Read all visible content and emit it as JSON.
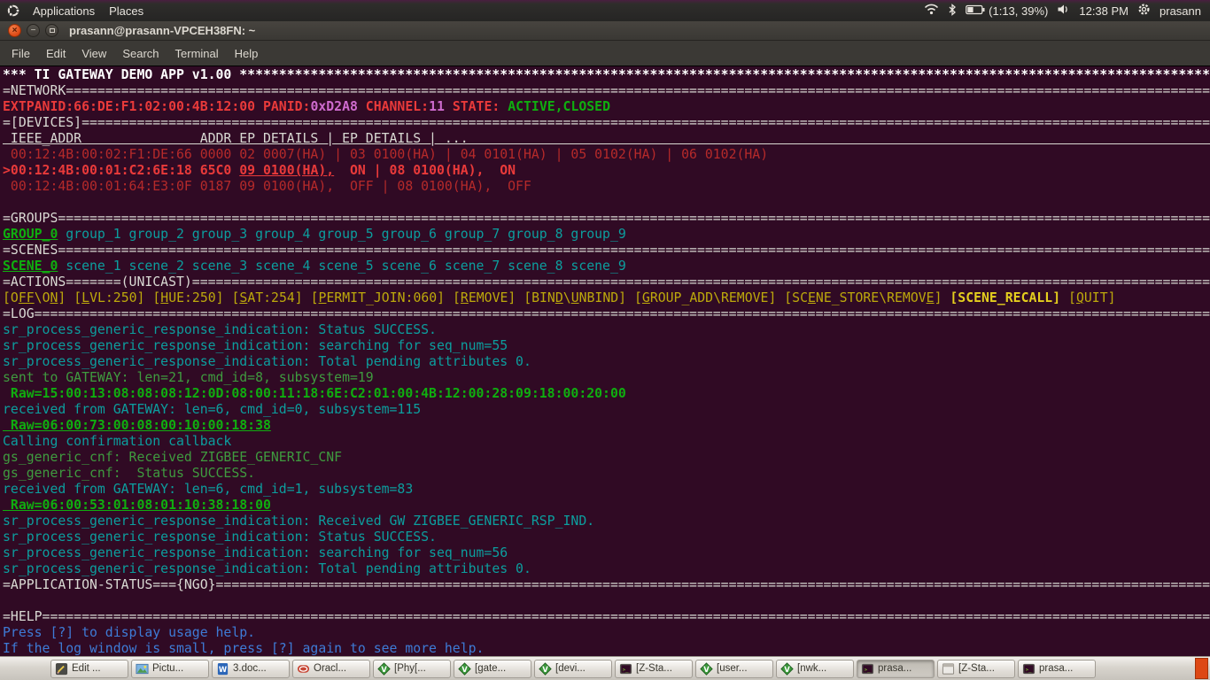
{
  "colors": {
    "white": "#D9D9D3",
    "red": "#B52A2A",
    "brightred": "#E93A3A",
    "magenta": "#CE6BCE",
    "green": "#3F9B3F",
    "brightgreen": "#0FAE0F",
    "teal": "#0C9E9E",
    "yellow": "#BCA80C",
    "brightyellow": "#E4CE1E",
    "blue": "#3E7BD6",
    "accentorange": "#DD4814",
    "terminalbg": "#300A24"
  },
  "panel": {
    "applications_label": "Applications",
    "places_label": "Places",
    "battery_text": "(1:13, 39%)",
    "clock": "12:38 PM",
    "username": "prasann"
  },
  "window": {
    "title": "prasann@prasann-VPCEH38FN: ~",
    "menu": [
      "File",
      "Edit",
      "View",
      "Search",
      "Terminal",
      "Help"
    ]
  },
  "terminal": {
    "lines": [
      {
        "seg": [
          {
            "t": "*** TI GATEWAY DEMO APP v1.00 ",
            "c": "wb",
            "pad": "*"
          }
        ]
      },
      {
        "seg": [
          {
            "t": "=NETWORK",
            "c": "w",
            "pad": "="
          }
        ]
      },
      {
        "seg": [
          {
            "t": "EXTPANID:66:DE:F1:02:00:4B:12:00 PANID:",
            "c": "rb"
          },
          {
            "t": "0xD2A8",
            "c": "m"
          },
          {
            "t": " CHANNEL:",
            "c": "rb"
          },
          {
            "t": "11",
            "c": "m"
          },
          {
            "t": " STATE: ",
            "c": "rb"
          },
          {
            "t": "ACTIVE,CLOSED",
            "c": "gb"
          }
        ]
      },
      {
        "seg": [
          {
            "t": "=[DEVICES]",
            "c": "w",
            "pad": "="
          }
        ]
      },
      {
        "seg": [
          {
            "t": " IEEE_ADDR               ADDR EP DETAILS | EP DETAILS | ...",
            "c": "w u",
            "pad": " "
          }
        ]
      },
      {
        "seg": [
          {
            "t": " 00:12:4B:00:02:F1:DE:66 0000 02 0007(HA) | 03 0100(HA) | 04 0101(HA) | 05 0102(HA) | 06 0102(HA)",
            "c": "r"
          }
        ]
      },
      {
        "seg": [
          {
            "t": ">00:12:4B:00:01:C2:6E:18 65C0 ",
            "c": "rb"
          },
          {
            "t": "09 0100(HA),",
            "c": "rb u"
          },
          {
            "t": "  ON | 08 0100(HA),  ON",
            "c": "rb"
          }
        ]
      },
      {
        "seg": [
          {
            "t": " 00:12:4B:00:01:64:E3:0F 0187 09 0100(HA),  OFF | 08 0100(HA),  OFF",
            "c": "r"
          }
        ]
      },
      {
        "seg": []
      },
      {
        "seg": [
          {
            "t": "=GROUPS",
            "c": "w",
            "pad": "="
          }
        ]
      },
      {
        "seg": [
          {
            "t": "GROUP_0",
            "c": "gb u"
          },
          {
            "t": " group_1 group_2 group_3 group_4 group_5 group_6 group_7 group_8 group_9",
            "c": "t"
          }
        ]
      },
      {
        "seg": [
          {
            "t": "=SCENES",
            "c": "w",
            "pad": "="
          }
        ]
      },
      {
        "seg": [
          {
            "t": "SCENE_0",
            "c": "gb u"
          },
          {
            "t": " scene_1 scene_2 scene_3 scene_4 scene_5 scene_6 scene_7 scene_8 scene_9",
            "c": "t"
          }
        ]
      },
      {
        "seg": [
          {
            "t": "=ACTIONS=======(UNICAST)",
            "c": "w",
            "pad": "="
          }
        ]
      },
      {
        "seg": [
          {
            "t": "[O",
            "c": "y"
          },
          {
            "t": "FF",
            "c": "y u"
          },
          {
            "t": "\\O",
            "c": "y"
          },
          {
            "t": "N",
            "c": "y u"
          },
          {
            "t": "] ",
            "c": "y"
          },
          {
            "t": "[",
            "c": "y"
          },
          {
            "t": "L",
            "c": "y u"
          },
          {
            "t": "VL:250] ",
            "c": "y"
          },
          {
            "t": "[",
            "c": "y"
          },
          {
            "t": "H",
            "c": "y u"
          },
          {
            "t": "UE:250] ",
            "c": "y"
          },
          {
            "t": "[",
            "c": "y"
          },
          {
            "t": "S",
            "c": "y u"
          },
          {
            "t": "AT:254] ",
            "c": "y"
          },
          {
            "t": "[",
            "c": "y"
          },
          {
            "t": "P",
            "c": "y u"
          },
          {
            "t": "ERMIT_JOIN:060] ",
            "c": "y"
          },
          {
            "t": "[",
            "c": "y"
          },
          {
            "t": "R",
            "c": "y u"
          },
          {
            "t": "EMOVE] ",
            "c": "y"
          },
          {
            "t": "[BIN",
            "c": "y"
          },
          {
            "t": "D",
            "c": "y u"
          },
          {
            "t": "\\",
            "c": "y"
          },
          {
            "t": "U",
            "c": "y u"
          },
          {
            "t": "NBIND] ",
            "c": "y"
          },
          {
            "t": "[",
            "c": "y"
          },
          {
            "t": "G",
            "c": "y u"
          },
          {
            "t": "ROUP_ADD\\REMOVE] ",
            "c": "y"
          },
          {
            "t": "[SC",
            "c": "y"
          },
          {
            "t": "E",
            "c": "y u"
          },
          {
            "t": "NE_STORE\\REMOV",
            "c": "y"
          },
          {
            "t": "E",
            "c": "y u"
          },
          {
            "t": "] ",
            "c": "y"
          },
          {
            "t": "[SCENE_RECALL]",
            "c": "yb"
          },
          {
            "t": " ",
            "c": "y"
          },
          {
            "t": "[",
            "c": "y"
          },
          {
            "t": "Q",
            "c": "y u"
          },
          {
            "t": "UIT]",
            "c": "y"
          }
        ]
      },
      {
        "seg": [
          {
            "t": "=LOG",
            "c": "w",
            "pad": "="
          }
        ]
      },
      {
        "seg": [
          {
            "t": "sr_process_generic_response_indication: Status SUCCESS.",
            "c": "t"
          }
        ]
      },
      {
        "seg": [
          {
            "t": "sr_process_generic_response_indication: searching for seq_num=55",
            "c": "t"
          }
        ]
      },
      {
        "seg": [
          {
            "t": "sr_process_generic_response_indication: Total pending attributes 0.",
            "c": "t"
          }
        ]
      },
      {
        "seg": [
          {
            "t": "sent to GATEWAY: len=21, cmd_id=8, subsystem=19",
            "c": "g"
          }
        ]
      },
      {
        "seg": [
          {
            "t": " Raw=15:00:13:08:08:08:12:0D:08:00:11:18:6E:C2:01:00:4B:12:00:28:09:18:00:20:00",
            "c": "gb"
          }
        ]
      },
      {
        "seg": [
          {
            "t": "received from GATEWAY: len=6, cmd_id=0, subsystem=115",
            "c": "t"
          }
        ]
      },
      {
        "seg": [
          {
            "t": " Raw=06:00:73:00:08:00:10:00:18:38",
            "c": "gb u"
          }
        ]
      },
      {
        "seg": [
          {
            "t": "Calling confirmation callback",
            "c": "t"
          }
        ]
      },
      {
        "seg": [
          {
            "t": "gs_generic_cnf: Received ZIGBEE_GENERIC_CNF",
            "c": "g"
          }
        ]
      },
      {
        "seg": [
          {
            "t": "gs_generic_cnf:  Status SUCCESS.",
            "c": "g"
          }
        ]
      },
      {
        "seg": [
          {
            "t": "received from GATEWAY: len=6, cmd_id=1, subsystem=83",
            "c": "t"
          }
        ]
      },
      {
        "seg": [
          {
            "t": " Raw=06:00:53:01:08:01:10:38:18:00",
            "c": "gb u"
          }
        ]
      },
      {
        "seg": [
          {
            "t": "sr_process_generic_response_indication: Received GW ZIGBEE_GENERIC_RSP_IND.",
            "c": "t"
          }
        ]
      },
      {
        "seg": [
          {
            "t": "sr_process_generic_response_indication: Status SUCCESS.",
            "c": "t"
          }
        ]
      },
      {
        "seg": [
          {
            "t": "sr_process_generic_response_indication: searching for seq_num=56",
            "c": "t"
          }
        ]
      },
      {
        "seg": [
          {
            "t": "sr_process_generic_response_indication: Total pending attributes 0.",
            "c": "t"
          }
        ]
      },
      {
        "seg": [
          {
            "t": "=APPLICATION-STATUS==={NGO}",
            "c": "w",
            "pad": "="
          }
        ]
      },
      {
        "seg": []
      },
      {
        "seg": [
          {
            "t": "=HELP",
            "c": "w",
            "pad": "="
          }
        ]
      },
      {
        "seg": [
          {
            "t": "Press [?] to display usage help.",
            "c": "b"
          }
        ]
      },
      {
        "seg": [
          {
            "t": "If the log window is small, press [?] again to see more help.",
            "c": "b"
          }
        ]
      }
    ]
  },
  "taskbar": {
    "items": [
      {
        "label": "Edit ...",
        "icon": "text-editor-icon",
        "active": false
      },
      {
        "label": "Pictu...",
        "icon": "pictures-icon",
        "active": false
      },
      {
        "label": "3.doc...",
        "icon": "word-doc-icon",
        "active": false
      },
      {
        "label": "Oracl...",
        "icon": "oracle-icon",
        "active": false
      },
      {
        "label": "[Phy[...",
        "icon": "gvim-icon",
        "active": false
      },
      {
        "label": "[gate...",
        "icon": "gvim-icon",
        "active": false
      },
      {
        "label": "[devi...",
        "icon": "gvim-icon",
        "active": false
      },
      {
        "label": "[Z-Sta...",
        "icon": "terminal-icon",
        "active": false
      },
      {
        "label": "[user...",
        "icon": "gvim-icon",
        "active": false
      },
      {
        "label": "[nwk...",
        "icon": "gvim-icon",
        "active": false
      },
      {
        "label": "prasa...",
        "icon": "terminal-icon",
        "active": true
      },
      {
        "label": "[Z-Sta...",
        "icon": "window-icon",
        "active": false
      },
      {
        "label": "prasa...",
        "icon": "terminal-icon",
        "active": false
      }
    ]
  }
}
